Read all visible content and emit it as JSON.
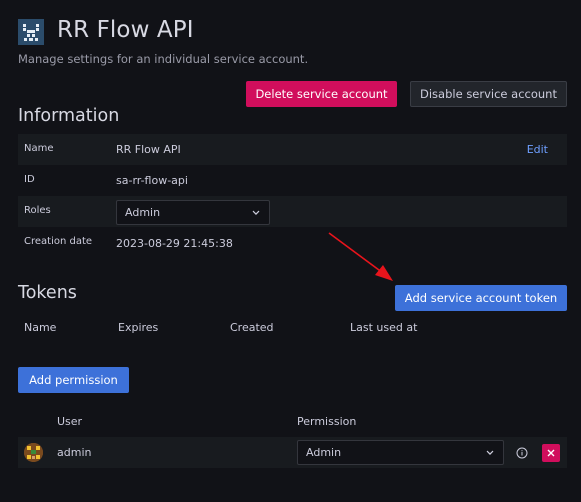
{
  "header": {
    "title": "RR Flow API",
    "subtitle": "Manage settings for an individual service account.",
    "delete_label": "Delete service account",
    "disable_label": "Disable service account"
  },
  "information": {
    "heading": "Information",
    "name_label": "Name",
    "name_value": "RR Flow API",
    "edit_label": "Edit",
    "id_label": "ID",
    "id_value": "sa-rr-flow-api",
    "roles_label": "Roles",
    "roles_value": "Admin",
    "created_label": "Creation date",
    "created_value": "2023-08-29 21:45:38"
  },
  "tokens": {
    "heading": "Tokens",
    "add_label": "Add service account token",
    "columns": [
      "Name",
      "Expires",
      "Created",
      "Last used at"
    ]
  },
  "permissions": {
    "add_label": "Add permission",
    "columns": [
      "User",
      "Permission"
    ],
    "rows": [
      {
        "user": "admin",
        "permission": "Admin"
      }
    ]
  },
  "colors": {
    "danger": "#d10e5c",
    "primary": "#3d71d9",
    "annotation_arrow": "#e8141c"
  },
  "icons": [
    "service-account-logo-icon",
    "chevron-down-icon",
    "info-circle-icon",
    "close-icon",
    "user-avatar-icon"
  ]
}
